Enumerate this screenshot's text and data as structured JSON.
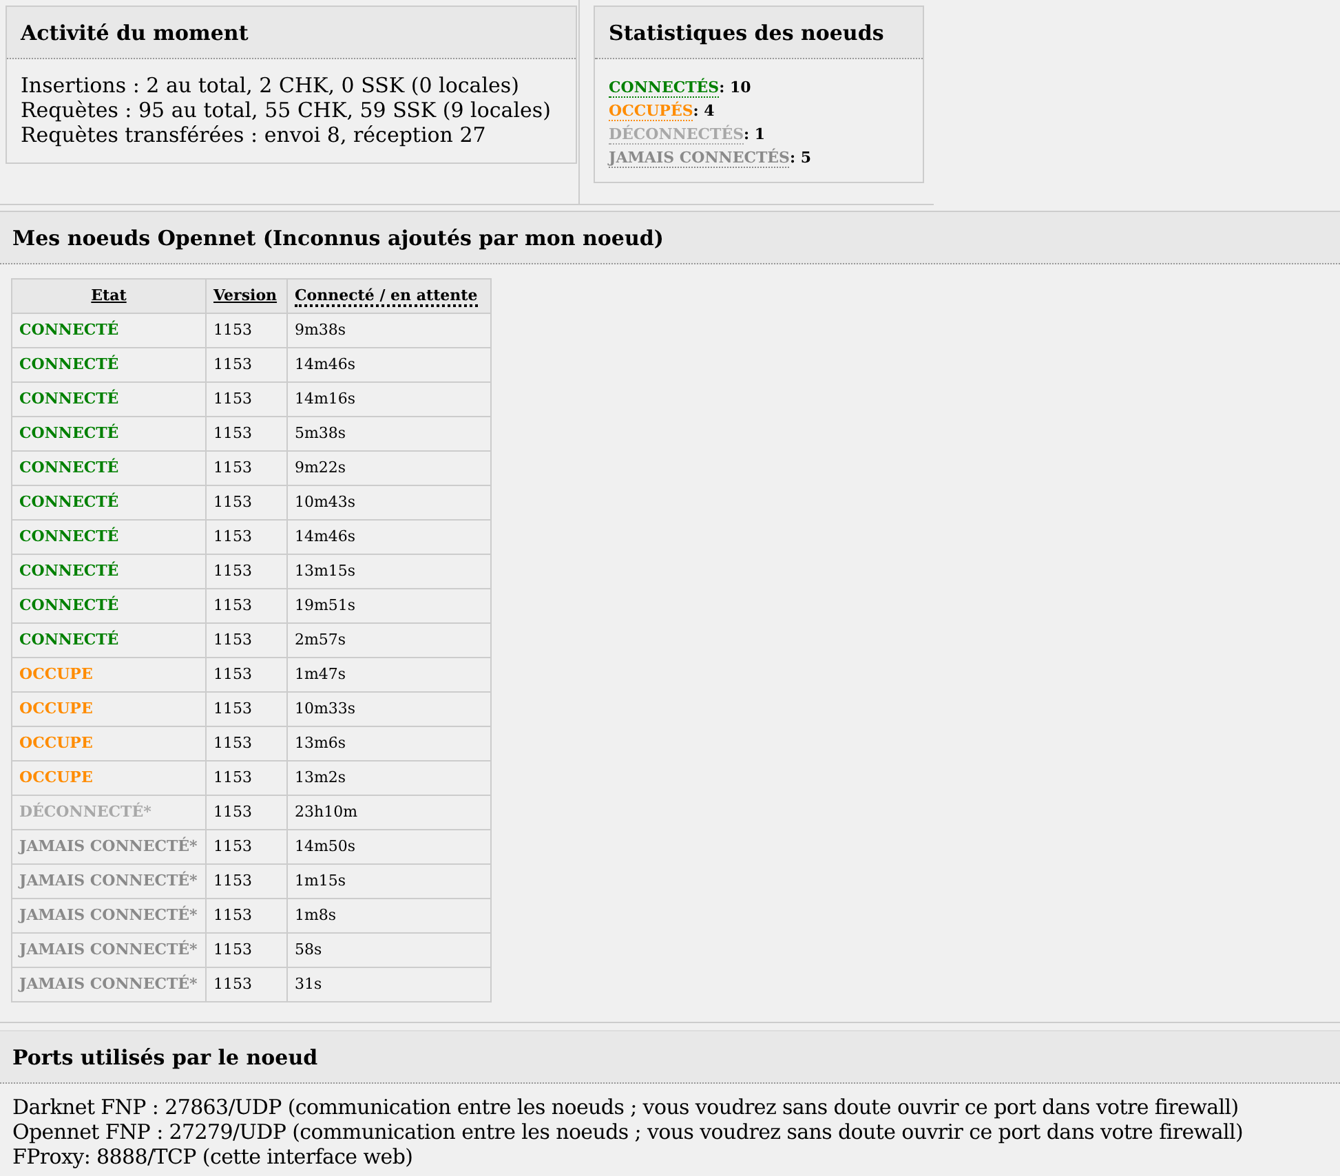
{
  "activity": {
    "title": "Activité du moment",
    "lines": [
      "Insertions : 2 au total, 2 CHK, 0 SSK (0 locales)",
      "Requètes : 95 au total, 55 CHK, 59 SSK (9 locales)",
      "Requètes transférées : envoi 8, réception 27"
    ]
  },
  "node_stats": {
    "title": "Statistiques des noeuds",
    "items": [
      {
        "kind": "connected",
        "label": "CONNECTÉS",
        "value": ": 10"
      },
      {
        "kind": "busy",
        "label": "OCCUPÉS",
        "value": ": 4"
      },
      {
        "kind": "disconnected",
        "label": "DÉCONNECTÉS",
        "value": ": 1"
      },
      {
        "kind": "never",
        "label": "JAMAIS CONNECTÉS",
        "value": ": 5"
      }
    ]
  },
  "opennet": {
    "title": "Mes noeuds Opennet (Inconnus ajoutés par mon noeud)",
    "columns": [
      "Etat",
      "Version",
      "Connecté / en attente"
    ],
    "rows": [
      {
        "kind": "connected",
        "status": "CONNECTÉ",
        "version": "1153",
        "time": "9m38s"
      },
      {
        "kind": "connected",
        "status": "CONNECTÉ",
        "version": "1153",
        "time": "14m46s"
      },
      {
        "kind": "connected",
        "status": "CONNECTÉ",
        "version": "1153",
        "time": "14m16s"
      },
      {
        "kind": "connected",
        "status": "CONNECTÉ",
        "version": "1153",
        "time": "5m38s"
      },
      {
        "kind": "connected",
        "status": "CONNECTÉ",
        "version": "1153",
        "time": "9m22s"
      },
      {
        "kind": "connected",
        "status": "CONNECTÉ",
        "version": "1153",
        "time": "10m43s"
      },
      {
        "kind": "connected",
        "status": "CONNECTÉ",
        "version": "1153",
        "time": "14m46s"
      },
      {
        "kind": "connected",
        "status": "CONNECTÉ",
        "version": "1153",
        "time": "13m15s"
      },
      {
        "kind": "connected",
        "status": "CONNECTÉ",
        "version": "1153",
        "time": "19m51s"
      },
      {
        "kind": "connected",
        "status": "CONNECTÉ",
        "version": "1153",
        "time": "2m57s"
      },
      {
        "kind": "busy",
        "status": "OCCUPE",
        "version": "1153",
        "time": "1m47s"
      },
      {
        "kind": "busy",
        "status": "OCCUPE",
        "version": "1153",
        "time": "10m33s"
      },
      {
        "kind": "busy",
        "status": "OCCUPE",
        "version": "1153",
        "time": "13m6s"
      },
      {
        "kind": "busy",
        "status": "OCCUPE",
        "version": "1153",
        "time": "13m2s"
      },
      {
        "kind": "disconnected",
        "status": "DÉCONNECTÉ*",
        "version": "1153",
        "time": "23h10m"
      },
      {
        "kind": "never",
        "status": "JAMAIS CONNECTÉ*",
        "version": "1153",
        "time": "14m50s"
      },
      {
        "kind": "never",
        "status": "JAMAIS CONNECTÉ*",
        "version": "1153",
        "time": "1m15s"
      },
      {
        "kind": "never",
        "status": "JAMAIS CONNECTÉ*",
        "version": "1153",
        "time": "1m8s"
      },
      {
        "kind": "never",
        "status": "JAMAIS CONNECTÉ*",
        "version": "1153",
        "time": "58s"
      },
      {
        "kind": "never",
        "status": "JAMAIS CONNECTÉ*",
        "version": "1153",
        "time": "31s"
      }
    ]
  },
  "ports": {
    "title": "Ports utilisés par le noeud",
    "lines": [
      "Darknet FNP : 27863/UDP (communication entre les noeuds ; vous voudrez sans doute ouvrir ce port dans votre firewall)",
      "Opennet FNP : 27279/UDP (communication entre les noeuds ; vous voudrez sans doute ouvrir ce port dans votre firewall)",
      "FProxy: 8888/TCP (cette interface web)"
    ]
  }
}
